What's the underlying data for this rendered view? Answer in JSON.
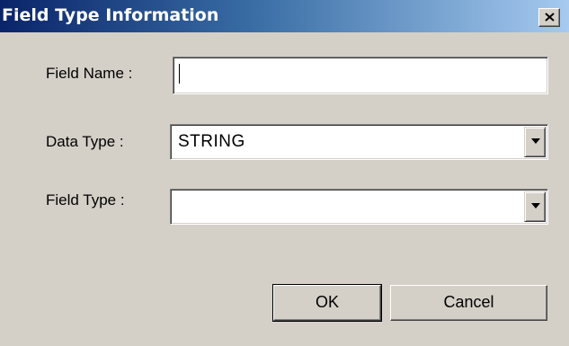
{
  "window": {
    "title": "Field Type Information",
    "close_icon": "close-icon"
  },
  "form": {
    "field_name": {
      "label": "Field Name :",
      "value": ""
    },
    "data_type": {
      "label": "Data Type  :",
      "selected": "STRING",
      "icon": "chevron-down-icon"
    },
    "field_type": {
      "label": "Field Type  :",
      "selected": "",
      "icon": "chevron-down-icon"
    }
  },
  "buttons": {
    "ok_label": "OK",
    "cancel_label": "Cancel"
  }
}
